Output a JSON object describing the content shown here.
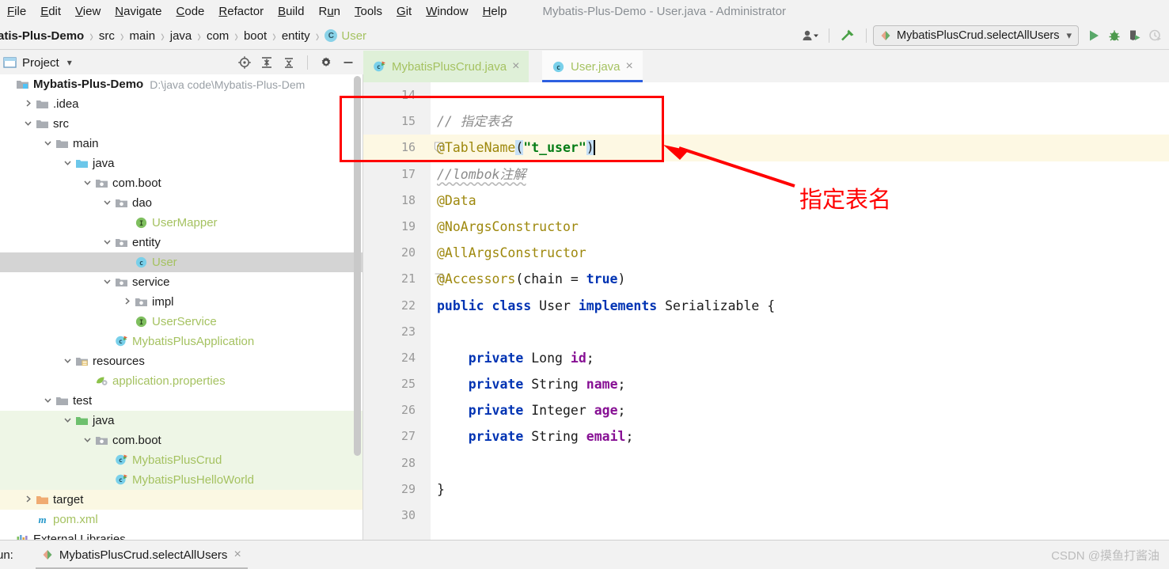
{
  "window": {
    "title": "Mybatis-Plus-Demo - User.java - Administrator"
  },
  "menubar": {
    "items": [
      {
        "label": "File",
        "mnemonic": "F"
      },
      {
        "label": "Edit",
        "mnemonic": "E"
      },
      {
        "label": "View",
        "mnemonic": "V"
      },
      {
        "label": "Navigate",
        "mnemonic": "N"
      },
      {
        "label": "Code",
        "mnemonic": "C"
      },
      {
        "label": "Refactor",
        "mnemonic": "R"
      },
      {
        "label": "Build",
        "mnemonic": "B"
      },
      {
        "label": "Run",
        "mnemonic": "u"
      },
      {
        "label": "Tools",
        "mnemonic": "T"
      },
      {
        "label": "Git",
        "mnemonic": "G"
      },
      {
        "label": "Window",
        "mnemonic": "W"
      },
      {
        "label": "Help",
        "mnemonic": "H"
      }
    ]
  },
  "breadcrumb": {
    "items": [
      "atis-Plus-Demo",
      "src",
      "main",
      "java",
      "com",
      "boot",
      "entity",
      "User"
    ],
    "leaf_badge": "C",
    "separator": "›"
  },
  "toolbar": {
    "user_icon": "user-avatar-icon",
    "hammer_icon": "build-hammer-icon",
    "run_config": "MybatisPlusCrud.selectAllUsers",
    "run_config_chevron": "⌄",
    "run_icon": "run-play-icon",
    "debug_icon": "debug-bug-icon",
    "coverage_icon": "run-with-coverage-icon",
    "profiler_icon": "profiler-clock-icon"
  },
  "project_panel": {
    "title": "Project",
    "chevron": "▾",
    "tools": [
      "locate-target-icon",
      "expand-all-icon",
      "collapse-all-icon",
      "settings-gear-icon",
      "hide-minimize-icon"
    ],
    "tree": [
      {
        "label": "Mybatis-Plus-Demo",
        "path": "D:\\java code\\Mybatis-Plus-Dem",
        "indent": 0,
        "arrow": "",
        "icon": "module-folder",
        "style": "bold",
        "state": "normal"
      },
      {
        "label": ".idea",
        "indent": 1,
        "arrow": "collapsed",
        "icon": "folder-grey",
        "style": "plain",
        "state": "normal"
      },
      {
        "label": "src",
        "indent": 1,
        "arrow": "expanded",
        "icon": "folder-grey",
        "style": "plain",
        "state": "normal"
      },
      {
        "label": "main",
        "indent": 2,
        "arrow": "expanded",
        "icon": "folder-grey",
        "style": "plain",
        "state": "normal"
      },
      {
        "label": "java",
        "indent": 3,
        "arrow": "expanded",
        "icon": "folder-source-blue",
        "style": "plain",
        "state": "normal"
      },
      {
        "label": "com.boot",
        "indent": 4,
        "arrow": "expanded",
        "icon": "package-grey",
        "style": "plain",
        "state": "normal"
      },
      {
        "label": "dao",
        "indent": 5,
        "arrow": "expanded",
        "icon": "package-grey",
        "style": "plain",
        "state": "normal"
      },
      {
        "label": "UserMapper",
        "indent": 6,
        "arrow": "none",
        "icon": "interface-green",
        "style": "green",
        "state": "normal"
      },
      {
        "label": "entity",
        "indent": 5,
        "arrow": "expanded",
        "icon": "package-grey",
        "style": "plain",
        "state": "normal"
      },
      {
        "label": "User",
        "indent": 6,
        "arrow": "none",
        "icon": "class-blue",
        "style": "green",
        "state": "selected"
      },
      {
        "label": "service",
        "indent": 5,
        "arrow": "expanded",
        "icon": "package-grey",
        "style": "plain",
        "state": "normal"
      },
      {
        "label": "impl",
        "indent": 6,
        "arrow": "collapsed",
        "icon": "package-grey",
        "style": "plain",
        "state": "normal"
      },
      {
        "label": "UserService",
        "indent": 6,
        "arrow": "none",
        "icon": "interface-green",
        "style": "green",
        "state": "normal"
      },
      {
        "label": "MybatisPlusApplication",
        "indent": 5,
        "arrow": "none",
        "icon": "class-runnable-blue",
        "style": "green",
        "state": "normal"
      },
      {
        "label": "resources",
        "indent": 3,
        "arrow": "expanded",
        "icon": "folder-resources",
        "style": "plain",
        "state": "normal"
      },
      {
        "label": "application.properties",
        "indent": 4,
        "arrow": "none",
        "icon": "properties-leaf",
        "style": "green",
        "state": "normal"
      },
      {
        "label": "test",
        "indent": 2,
        "arrow": "expanded",
        "icon": "folder-grey",
        "style": "plain",
        "state": "normal"
      },
      {
        "label": "java",
        "indent": 3,
        "arrow": "expanded",
        "icon": "folder-test-green",
        "style": "plain",
        "state": "test"
      },
      {
        "label": "com.boot",
        "indent": 4,
        "arrow": "expanded",
        "icon": "package-grey",
        "style": "plain",
        "state": "test"
      },
      {
        "label": "MybatisPlusCrud",
        "indent": 5,
        "arrow": "none",
        "icon": "class-runnable-blue",
        "style": "green",
        "state": "test"
      },
      {
        "label": "MybatisPlusHelloWorld",
        "indent": 5,
        "arrow": "none",
        "icon": "class-runnable-blue",
        "style": "green",
        "state": "test"
      },
      {
        "label": "target",
        "indent": 1,
        "arrow": "collapsed",
        "icon": "folder-excluded-orange",
        "style": "plain",
        "state": "excluded"
      },
      {
        "label": "pom.xml",
        "indent": 1,
        "arrow": "none",
        "icon": "maven-m-icon",
        "style": "green",
        "state": "normal"
      },
      {
        "label": "External Libraries",
        "indent": 0,
        "arrow": "none",
        "icon": "libraries-icon",
        "style": "plain",
        "state": "normal"
      }
    ]
  },
  "editor": {
    "tabs": [
      {
        "label": "MybatisPlusCrud.java",
        "icon": "class-runnable-blue",
        "active": false,
        "close": "×"
      },
      {
        "label": "User.java",
        "icon": "class-blue",
        "active": true,
        "close": "×"
      }
    ],
    "first_line_number": 14,
    "lines": [
      {
        "num": "14",
        "text": "",
        "highlight": false
      },
      {
        "num": "15",
        "text": "// 指定表名",
        "highlight": false
      },
      {
        "num": "16",
        "text": "@TableName(\"t_user\")",
        "highlight": true
      },
      {
        "num": "17",
        "text": "//lombok注解",
        "highlight": false
      },
      {
        "num": "18",
        "text": "@Data",
        "highlight": false
      },
      {
        "num": "19",
        "text": "@NoArgsConstructor",
        "highlight": false
      },
      {
        "num": "20",
        "text": "@AllArgsConstructor",
        "highlight": false
      },
      {
        "num": "21",
        "text": "@Accessors(chain = true)",
        "highlight": false
      },
      {
        "num": "22",
        "text": "public class User implements Serializable {",
        "highlight": false
      },
      {
        "num": "23",
        "text": "",
        "highlight": false
      },
      {
        "num": "24",
        "text": "    private Long id;",
        "highlight": false
      },
      {
        "num": "25",
        "text": "    private String name;",
        "highlight": false
      },
      {
        "num": "26",
        "text": "    private Integer age;",
        "highlight": false
      },
      {
        "num": "27",
        "text": "    private String email;",
        "highlight": false
      },
      {
        "num": "28",
        "text": "",
        "highlight": false
      },
      {
        "num": "29",
        "text": "}",
        "highlight": false
      },
      {
        "num": "30",
        "text": "",
        "highlight": false
      }
    ]
  },
  "annotation": {
    "text": "指定表名",
    "color": "#ff0000"
  },
  "run_bar": {
    "label": "un:",
    "tab": "MybatisPlusCrud.selectAllUsers",
    "close": "×",
    "icon": "run-config-icon"
  },
  "watermark": {
    "text": "CSDN @摸鱼打酱油"
  },
  "colors": {
    "accent_blue": "#2d5fe0",
    "annotation_red": "#ff0000",
    "green_text": "#a5c261",
    "string_green": "#067d17",
    "keyword_blue": "#0033b3",
    "annotation_gold": "#9e880d",
    "field_purple": "#871094",
    "line_highlight": "#fdf8e3",
    "test_bg": "#eef6e6",
    "excluded_bg": "#fbf8e3"
  }
}
